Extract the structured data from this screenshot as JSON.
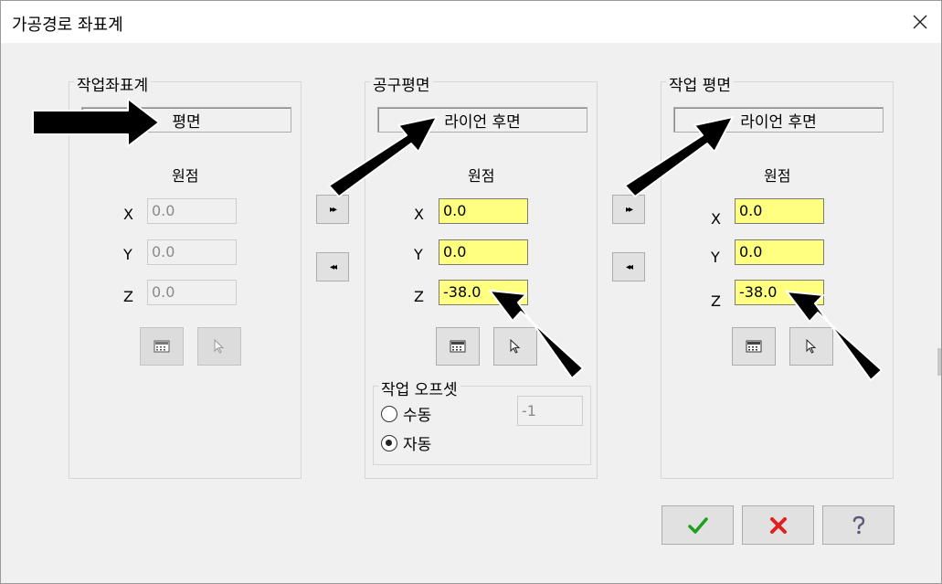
{
  "window": {
    "title": "가공경로 좌표계"
  },
  "panels": [
    {
      "title": "작업좌표계",
      "plane": "평면",
      "origin_label": "원점",
      "fields": [
        {
          "axis": "X",
          "value": "0.0",
          "state": "disabled"
        },
        {
          "axis": "Y",
          "value": "0.0",
          "state": "disabled"
        },
        {
          "axis": "Z",
          "value": "0.0",
          "state": "disabled"
        }
      ]
    },
    {
      "title": "공구평면",
      "plane": "라이언 후면",
      "origin_label": "원점",
      "fields": [
        {
          "axis": "X",
          "value": "0.0",
          "state": "active"
        },
        {
          "axis": "Y",
          "value": "0.0",
          "state": "active"
        },
        {
          "axis": "Z",
          "value": "-38.0",
          "state": "active"
        }
      ]
    },
    {
      "title": "작업 평면",
      "plane": "라이언 후면",
      "origin_label": "원점",
      "fields": [
        {
          "axis": "X",
          "value": "0.0",
          "state": "active"
        },
        {
          "axis": "Y",
          "value": "0.0",
          "state": "active"
        },
        {
          "axis": "Z",
          "value": "-38.0",
          "state": "active"
        }
      ]
    }
  ],
  "offset": {
    "title": "작업 오프셋",
    "options": [
      {
        "label": "수동",
        "checked": false
      },
      {
        "label": "자동",
        "checked": true
      }
    ],
    "value": "-1"
  },
  "copy_buttons": {
    "forward": "▸▸",
    "back": "◂◂"
  },
  "icons": {
    "close": "close-icon",
    "ok": "checkmark-icon",
    "cancel": "cancel-x-icon",
    "help": "help-icon",
    "calculator": "calculator-icon",
    "select": "cursor-select-icon"
  },
  "colors": {
    "active_field": "#ffff80",
    "ok_green": "#1ea01e",
    "cancel_red": "#e02020",
    "annotation_arrow": "#000000"
  }
}
